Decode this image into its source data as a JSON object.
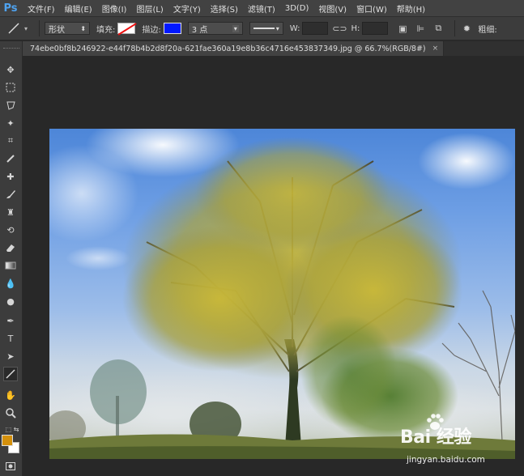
{
  "app": {
    "logo": "Ps",
    "menu": [
      "文件(F)",
      "编辑(E)",
      "图像(I)",
      "图层(L)",
      "文字(Y)",
      "选择(S)",
      "滤镜(T)",
      "3D(D)",
      "视图(V)",
      "窗口(W)",
      "帮助(H)"
    ]
  },
  "options": {
    "mode_value": "形状",
    "fill_label": "填充:",
    "stroke_label": "描边:",
    "stroke_width_value": "3 点",
    "w_label": "W:",
    "h_label": "H:",
    "weight_label": "粗细:",
    "fill_color": "#ffffff",
    "stroke_color": "#0018ff"
  },
  "document": {
    "tab_title": "74ebe0bf8b246922-e44f78b4b2d8f20a-621fae360a19e8b36c4716e453837349.jpg @ 66.7%(RGB/8#)",
    "close_glyph": "×"
  },
  "colors": {
    "foreground": "#d4900c",
    "background": "#ffffff",
    "accent": "#4fa3f0"
  },
  "watermark": {
    "main": "Bai 经验",
    "sub": "jingyan.baidu.com"
  }
}
